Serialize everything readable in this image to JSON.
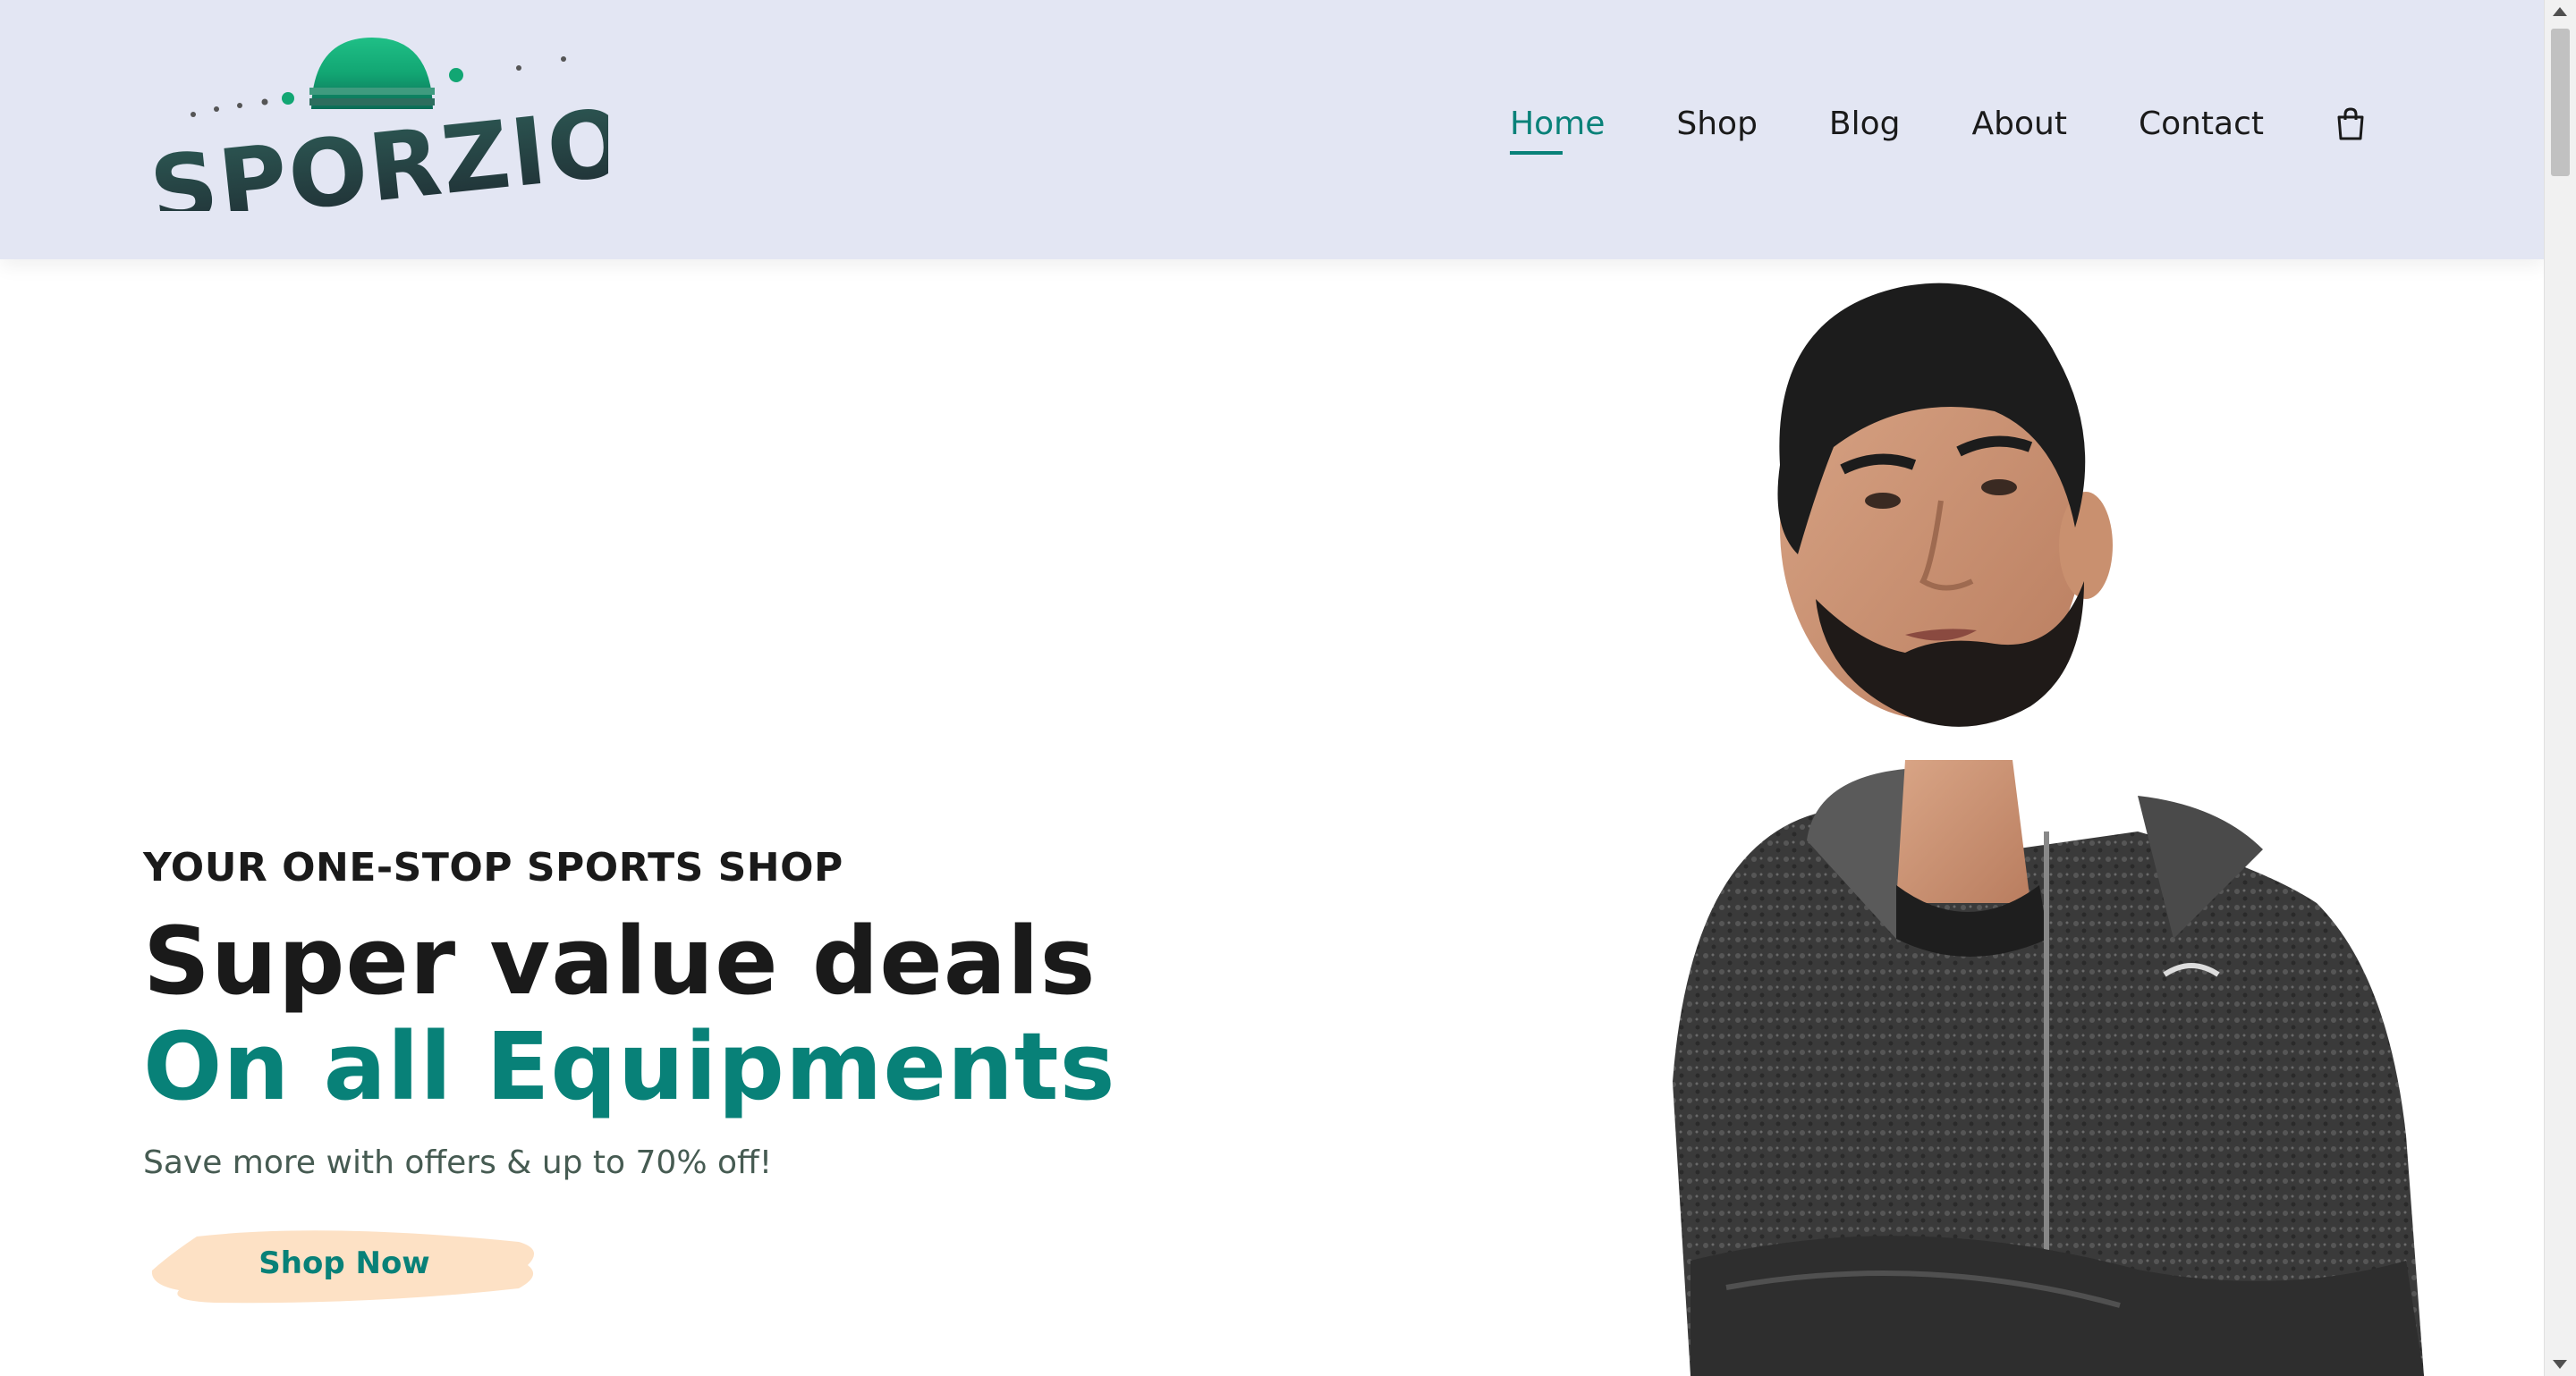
{
  "brand": {
    "name": "SPORZIO",
    "accent": "#088178",
    "header_bg": "#e3e6f3"
  },
  "nav": {
    "items": [
      {
        "label": "Home",
        "active": true
      },
      {
        "label": "Shop",
        "active": false
      },
      {
        "label": "Blog",
        "active": false
      },
      {
        "label": "About",
        "active": false
      },
      {
        "label": "Contact",
        "active": false
      }
    ],
    "cart_icon": "shopping-bag-icon"
  },
  "hero": {
    "eyebrow": "YOUR ONE-STOP SPORTS SHOP",
    "title_line1": "Super value deals",
    "title_line2": "On all Equipments",
    "subtitle": "Save more with offers & up to 70% off!",
    "cta_label": "Shop Now",
    "cta_bg": "#fde1c5"
  }
}
